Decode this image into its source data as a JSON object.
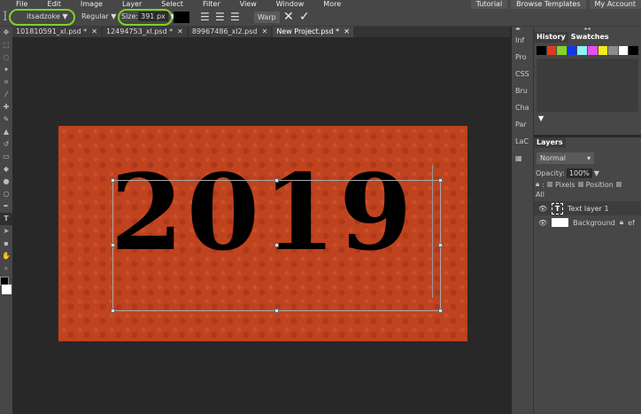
{
  "menu": [
    "File",
    "Edit",
    "Image",
    "Layer",
    "Select",
    "Filter",
    "View",
    "Window",
    "More"
  ],
  "menu_right": [
    "Tutorial",
    "Browse Templates",
    "My Account"
  ],
  "options": {
    "font": "itsadzoke",
    "style": "Regular",
    "size_label": "Size:",
    "size": "391 px",
    "warp": "Warp",
    "cancel": "✕",
    "commit": "✓"
  },
  "tabs": [
    {
      "label": "101810591_xl.psd *"
    },
    {
      "label": "12494753_xl.psd *"
    },
    {
      "label": "89967486_xl2.psd"
    },
    {
      "label": "New Project.psd *"
    }
  ],
  "tab_close": "✕",
  "canvas": {
    "text": "2019"
  },
  "side_strip": [
    "Inf",
    "Pro",
    "CSS",
    "Bru",
    "Cha",
    "Par",
    "LaC"
  ],
  "history": {
    "tabs": [
      "History",
      "Swatches"
    ],
    "swatches": [
      "#000000",
      "#e03a1e",
      "#84d42c",
      "#1236e8",
      "#8ef2f6",
      "#e94ef0",
      "#f7ea1c",
      "#8c8c8c",
      "#ffffff",
      "#000000"
    ]
  },
  "layers": {
    "title": "Layers",
    "blend": "Normal",
    "opacity_label": "Opacity:",
    "opacity": "100%",
    "lock_label": ":",
    "lock_options": [
      "Pixels",
      "Position",
      "All"
    ],
    "items": [
      {
        "name": "Text layer 1"
      },
      {
        "name": "Background"
      }
    ],
    "fx": "ef"
  }
}
